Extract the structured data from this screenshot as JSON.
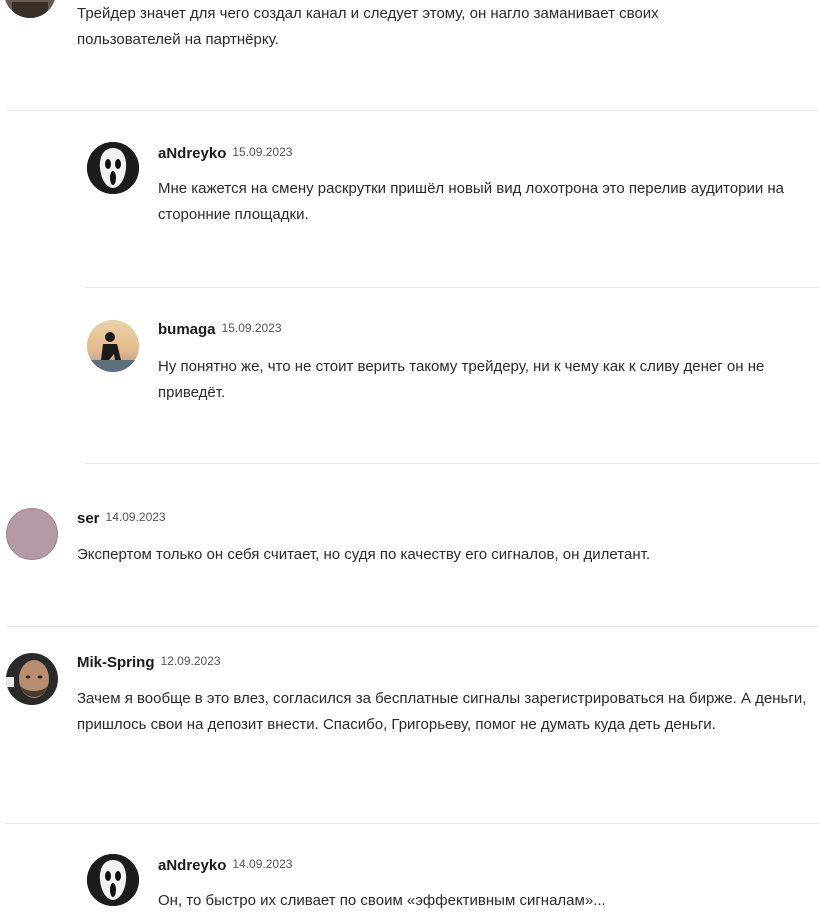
{
  "comments": [
    {
      "author": "",
      "date": "",
      "text": "Трейдер значет для чего создал канал и следует этому, он нагло заманивает своих пользователей на партнёрку."
    },
    {
      "author": "aNdreyko",
      "date": "15.09.2023",
      "text": "Мне кажется на смену раскрутки пришёл новый вид лохотрона это перелив аудитории на сторонние площадки."
    },
    {
      "author": "bumaga",
      "date": "15.09.2023",
      "text": "Ну понятно же, что не стоит верить такому трейдеру, ни к чему как к сливу денег он не приведёт."
    },
    {
      "author": "ser",
      "date": "14.09.2023",
      "text": "Экспертом только он себя считает, но судя по качеству его сигналов, он дилетант."
    },
    {
      "author": "Mik-Spring",
      "date": "12.09.2023",
      "text": "Зачем я вообще в это влез, согласился за бесплатные сигналы зарегистрироваться на бирже. А деньги, пришлось свои на депозит внести. Спасибо, Григорьеву, помог не думать куда деть деньги."
    },
    {
      "author": "aNdreyko",
      "date": "14.09.2023",
      "text": "Он, то быстро их сливает по своим «эффективным сигналам»..."
    }
  ],
  "colors": {
    "divider": "#e6e6e6",
    "ser_avatar": "#b39aa6"
  },
  "icons": {
    "scream_mask": "scream-mask-avatar",
    "silhouette": "silhouette-sunset-avatar",
    "bald_man": "bald-man-avatar"
  }
}
